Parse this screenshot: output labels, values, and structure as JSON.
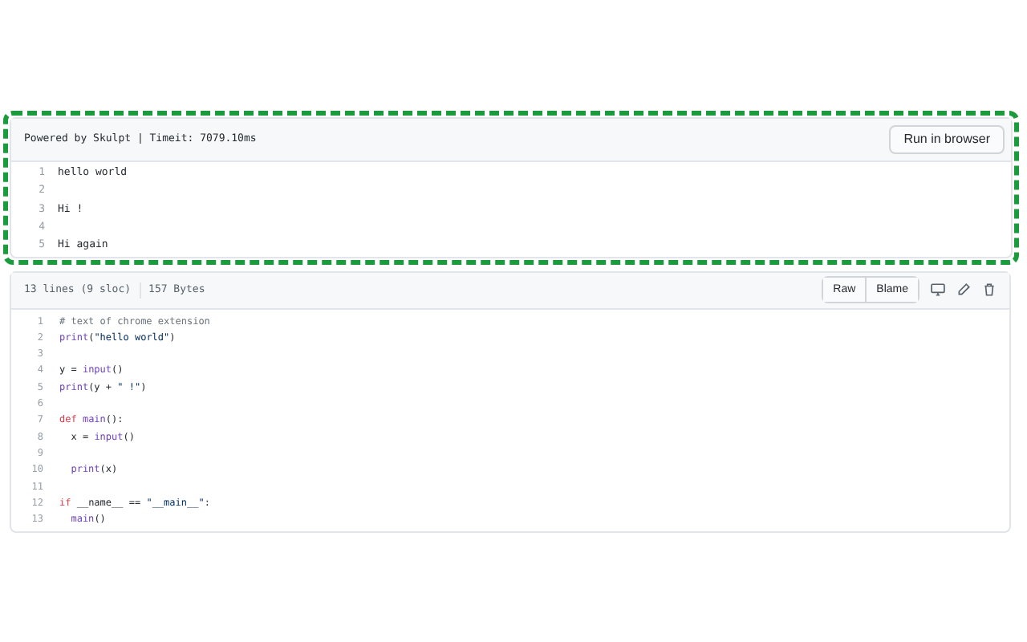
{
  "output_panel": {
    "info": "Powered by Skulpt | Timeit: 7079.10ms",
    "run_button": "Run in browser",
    "lines": [
      {
        "number": "1",
        "text": "hello world"
      },
      {
        "number": "2"
      },
      {
        "number": "3",
        "text": "Hi !"
      },
      {
        "number": "4"
      },
      {
        "number": "5",
        "text": "Hi again"
      }
    ]
  },
  "file_panel": {
    "lines_info": "13 lines (9 sloc)",
    "size": "157 Bytes",
    "buttons": [
      "Raw",
      "Blame"
    ],
    "code": [
      {
        "number": "1",
        "tokens": [
          {
            "text": "# text of chrome extension",
            "kind": "comment"
          }
        ]
      },
      {
        "number": "2",
        "tokens": [
          {
            "text": "print",
            "kind": "function"
          },
          {
            "text": "(",
            "kind": "plain"
          },
          {
            "text": "\"hello world\"",
            "kind": "string"
          },
          {
            "text": ")",
            "kind": "plain"
          }
        ]
      },
      {
        "number": "3"
      },
      {
        "number": "4",
        "tokens": [
          {
            "text": "y = ",
            "kind": "plain"
          },
          {
            "text": "input",
            "kind": "function"
          },
          {
            "text": "()",
            "kind": "plain"
          }
        ]
      },
      {
        "number": "5",
        "tokens": [
          {
            "text": "print",
            "kind": "function"
          },
          {
            "text": "(y + ",
            "kind": "plain"
          },
          {
            "text": "\" !\"",
            "kind": "string"
          },
          {
            "text": ")",
            "kind": "plain"
          }
        ]
      },
      {
        "number": "6"
      },
      {
        "number": "7",
        "tokens": [
          {
            "text": "def ",
            "kind": "keyword"
          },
          {
            "text": "main",
            "kind": "function"
          },
          {
            "text": "():",
            "kind": "plain"
          }
        ]
      },
      {
        "number": "8",
        "tokens": [
          {
            "text": "  x = ",
            "kind": "plain"
          },
          {
            "text": "input",
            "kind": "function"
          },
          {
            "text": "()",
            "kind": "plain"
          }
        ]
      },
      {
        "number": "9"
      },
      {
        "number": "10",
        "tokens": [
          {
            "text": "  print",
            "kind": "function"
          },
          {
            "text": "(x)",
            "kind": "plain"
          }
        ]
      },
      {
        "number": "11"
      },
      {
        "number": "12",
        "tokens": [
          {
            "text": "if ",
            "kind": "keyword"
          },
          {
            "text": "__name__ == ",
            "kind": "plain"
          },
          {
            "text": "\"__main__\"",
            "kind": "string"
          },
          {
            "text": ":",
            "kind": "plain"
          }
        ]
      },
      {
        "number": "13",
        "tokens": [
          {
            "text": "  main",
            "kind": "function"
          },
          {
            "text": "()",
            "kind": "plain"
          }
        ]
      }
    ]
  }
}
